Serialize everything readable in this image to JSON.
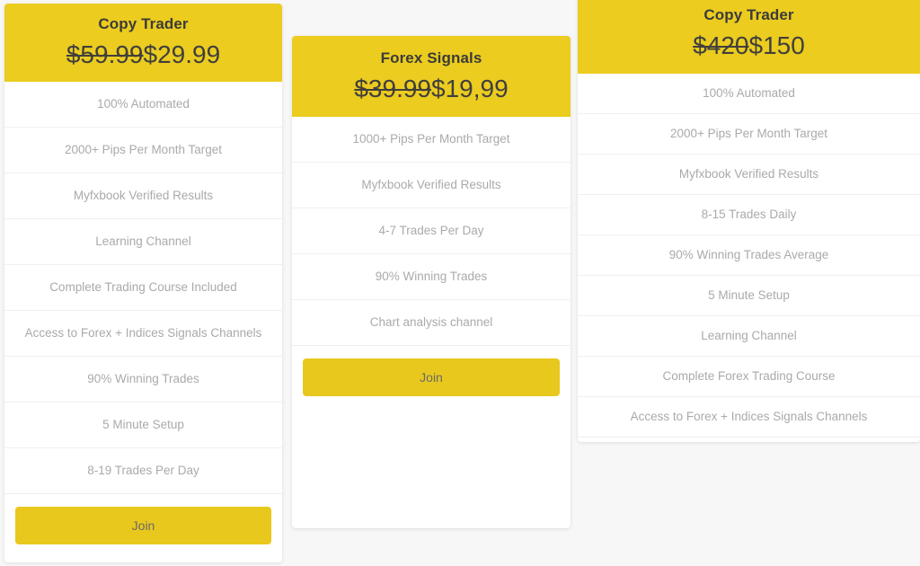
{
  "page": {
    "background_color": "#f7f7f7",
    "accent_color": "#ebcc1f",
    "feature_text_color": "#aaaaaa",
    "title_text_color": "#3c3b39"
  },
  "cards": [
    {
      "id": "copy-trader-basic",
      "title": "Copy Trader",
      "price_old": "$59.99",
      "price_new": "$29.99",
      "features": [
        "100% Automated",
        "2000+ Pips Per Month Target",
        "Myfxbook Verified Results",
        "Learning Channel",
        "Complete Trading Course Included",
        "Access to Forex + Indices Signals Channels",
        "90% Winning Trades",
        "5 Minute Setup",
        "8-19 Trades Per Day"
      ],
      "cta_label": "Join"
    },
    {
      "id": "forex-signals",
      "title": "Forex Signals",
      "price_old": "$39.99",
      "price_new": "$19,99",
      "features": [
        "1000+ Pips Per Month Target",
        "Myfxbook Verified Results",
        "4-7 Trades Per Day",
        "90% Winning Trades",
        "Chart analysis channel"
      ],
      "cta_label": "Join"
    },
    {
      "id": "copy-trader-premium",
      "title": "Copy Trader",
      "price_old": "$420",
      "price_new": "$150",
      "features": [
        "100% Automated",
        "2000+ Pips Per Month Target",
        "Myfxbook Verified Results",
        "8-15 Trades Daily",
        "90% Winning Trades Average",
        "5 Minute Setup",
        "Learning Channel",
        "Complete Forex Trading Course",
        "Access to Forex + Indices Signals Channels"
      ],
      "cta_label": null
    }
  ]
}
